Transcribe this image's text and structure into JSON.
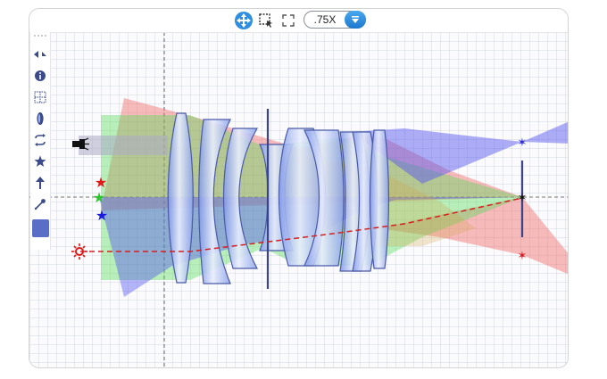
{
  "toolbar_top": {
    "move_icon": "move-arrows-icon",
    "select_icon": "marquee-select-icon",
    "fit_icon": "fit-screen-icon",
    "zoom_value": ".75X",
    "zoom_dropdown_icon": "chevron-down-icon"
  },
  "side_tools": [
    {
      "name": "collapse-expand-icon"
    },
    {
      "name": "info-icon"
    },
    {
      "name": "grid-icon"
    },
    {
      "name": "lens-icon"
    },
    {
      "name": "swap-icon"
    },
    {
      "name": "star-icon"
    },
    {
      "name": "arrow-up-icon"
    },
    {
      "name": "eyedropper-icon"
    }
  ],
  "colors": {
    "accent": "#1c78cf",
    "swatch": "#5b6ec7",
    "ray_red": "#f06a6a",
    "ray_green": "#55dd55",
    "ray_blue": "#5c5cf0",
    "lens_glass": "#8fa7ec",
    "lens_edge": "#4a5aa8"
  },
  "scene": {
    "light_source_icon": "flashlight-icon",
    "point_source_icon": "sun-icon",
    "object_markers": [
      "red-star",
      "green-star",
      "blue-star"
    ],
    "image_markers": [
      "blue-star",
      "black-star",
      "red-star"
    ]
  }
}
